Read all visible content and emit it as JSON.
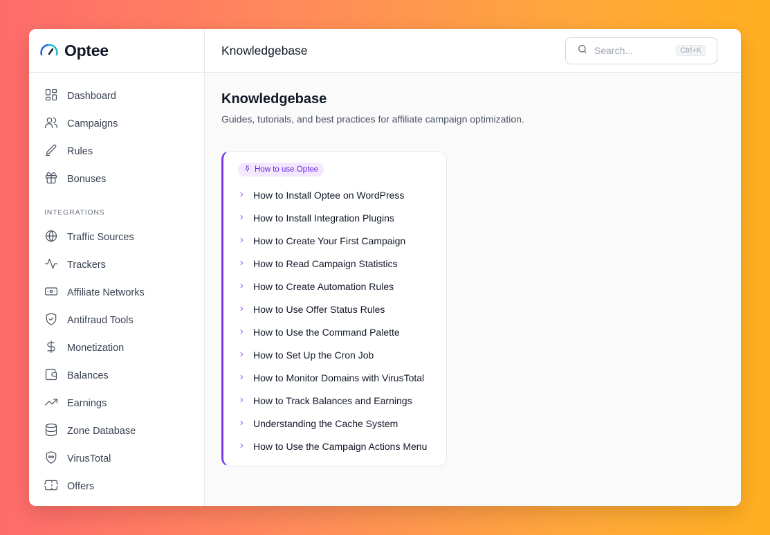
{
  "brand": {
    "name": "Optee"
  },
  "sidebar": {
    "main_items": [
      {
        "label": "Dashboard",
        "icon": "dashboard-icon"
      },
      {
        "label": "Campaigns",
        "icon": "users-icon"
      },
      {
        "label": "Rules",
        "icon": "pencil-icon"
      },
      {
        "label": "Bonuses",
        "icon": "gift-icon"
      }
    ],
    "section_label": "INTEGRATIONS",
    "integration_items": [
      {
        "label": "Traffic Sources",
        "icon": "globe-icon"
      },
      {
        "label": "Trackers",
        "icon": "activity-icon"
      },
      {
        "label": "Affiliate Networks",
        "icon": "banknote-icon"
      },
      {
        "label": "Antifraud Tools",
        "icon": "shield-check-icon"
      },
      {
        "label": "Monetization",
        "icon": "dollar-icon"
      },
      {
        "label": "Balances",
        "icon": "wallet-icon"
      },
      {
        "label": "Earnings",
        "icon": "trending-up-icon"
      },
      {
        "label": "Zone Database",
        "icon": "database-icon"
      },
      {
        "label": "VirusTotal",
        "icon": "shield-mask-icon"
      },
      {
        "label": "Offers",
        "icon": "ticket-icon"
      }
    ]
  },
  "header": {
    "title": "Knowledgebase",
    "search_placeholder": "Search...",
    "search_shortcut": "Ctrl+K"
  },
  "page": {
    "title": "Knowledgebase",
    "subtitle": "Guides, tutorials, and best practices for affiliate campaign optimization."
  },
  "card": {
    "badge": "How to use Optee",
    "accent": "#7c3aed",
    "articles": [
      "How to Install Optee on WordPress",
      "How to Install Integration Plugins",
      "How to Create Your First Campaign",
      "How to Read Campaign Statistics",
      "How to Create Automation Rules",
      "How to Use Offer Status Rules",
      "How to Use the Command Palette",
      "How to Set Up the Cron Job",
      "How to Monitor Domains with VirusTotal",
      "How to Track Balances and Earnings",
      "Understanding the Cache System",
      "How to Use the Campaign Actions Menu"
    ]
  }
}
